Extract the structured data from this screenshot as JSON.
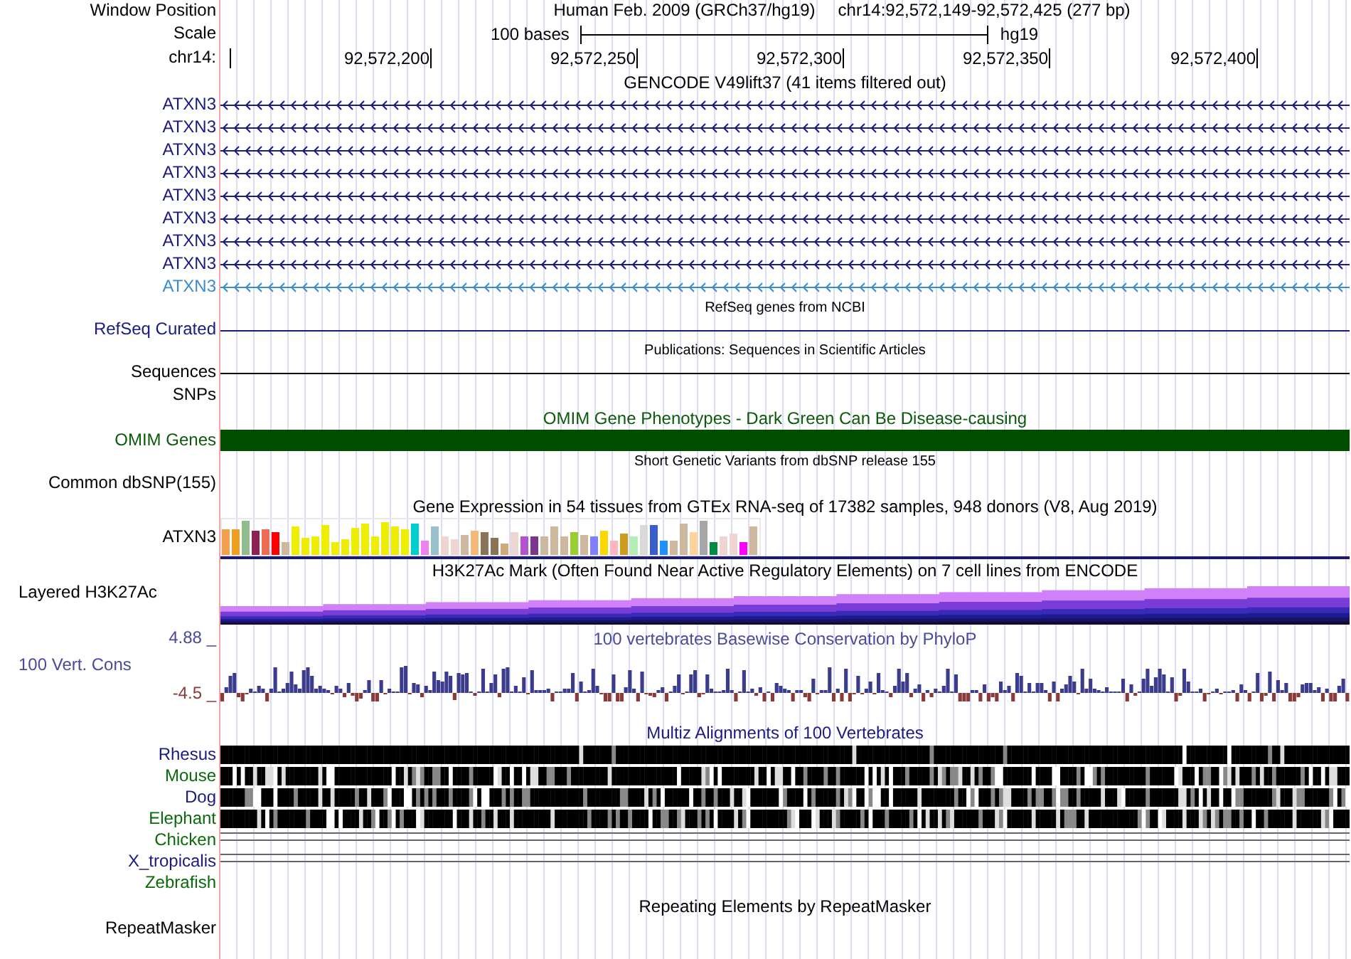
{
  "header": {
    "row_labels": [
      "Window Position",
      "Scale",
      "chr14:"
    ],
    "assembly": "Human Feb. 2009 (GRCh37/hg19)",
    "position": "chr14:92,572,149-92,572,425 (277 bp)",
    "scale_text": "100 bases",
    "scale_assembly": "hg19",
    "ticks": [
      "92,572,200",
      "92,572,250",
      "92,572,300",
      "92,572,350",
      "92,572,400"
    ]
  },
  "tracks": [
    {
      "kind": "title",
      "text": "GENCODE V49lift37 (41 items filtered out)",
      "small": false,
      "color": "#000000"
    },
    {
      "kind": "gene",
      "label": "ATXN3",
      "color": "#1a1a80"
    },
    {
      "kind": "gene",
      "label": "ATXN3",
      "color": "#1a1a80"
    },
    {
      "kind": "gene",
      "label": "ATXN3",
      "color": "#1a1a80"
    },
    {
      "kind": "gene",
      "label": "ATXN3",
      "color": "#1a1a80"
    },
    {
      "kind": "gene",
      "label": "ATXN3",
      "color": "#1a1a80"
    },
    {
      "kind": "gene",
      "label": "ATXN3",
      "color": "#1a1a80"
    },
    {
      "kind": "gene",
      "label": "ATXN3",
      "color": "#1a1a80"
    },
    {
      "kind": "gene",
      "label": "ATXN3",
      "color": "#1a1a80"
    },
    {
      "kind": "gene",
      "label": "ATXN3",
      "color": "#3a8cd0"
    },
    {
      "kind": "title",
      "text": "RefSeq genes from NCBI",
      "small": true,
      "color": "#000000"
    },
    {
      "kind": "line",
      "label": "RefSeq Curated",
      "color": "#1a1a80"
    },
    {
      "kind": "title",
      "text": "Publications: Sequences in Scientific Articles",
      "small": true,
      "color": "#000000"
    },
    {
      "kind": "line",
      "label": "Sequences",
      "color": "#000000"
    },
    {
      "kind": "empty",
      "label": "SNPs",
      "color": "#000000"
    },
    {
      "kind": "title",
      "text": "OMIM Gene Phenotypes - Dark Green Can Be Disease-causing",
      "small": false,
      "color": "#0a5a0a"
    },
    {
      "kind": "bar",
      "label": "OMIM Genes",
      "color": "#0a5a0a"
    },
    {
      "kind": "title",
      "text": "Short Genetic Variants from dbSNP release 155",
      "small": true,
      "color": "#000000"
    },
    {
      "kind": "empty",
      "label": "Common dbSNP(155)",
      "color": "#000000"
    },
    {
      "kind": "title",
      "text": "Gene Expression in 54 tissues from GTEx RNA-seq of 17382 samples, 948 donors (V8, Aug 2019)",
      "small": false,
      "color": "#000000"
    },
    {
      "kind": "expression",
      "label": "ATXN3",
      "color": "#000000"
    },
    {
      "kind": "title",
      "text": "H3K27Ac Mark (Often Found Near Active Regulatory Elements) on 7 cell lines from ENCODE",
      "small": false,
      "color": "#000000"
    },
    {
      "kind": "layered",
      "label": "Layered H3K27Ac",
      "color": "#000000"
    },
    {
      "kind": "wiggle",
      "label": "100 Vert. Cons",
      "title": "100 vertebrates Basewise Conservation by PhyloP",
      "max": "4.88 _",
      "min": "-4.5 _",
      "color": "#4a4a9a"
    },
    {
      "kind": "title",
      "text": "Multiz Alignments of 100 Vertebrates",
      "small": false,
      "color": "#1a1a80"
    },
    {
      "kind": "alignment",
      "label": "Rhesus",
      "color": "#1a1a80"
    },
    {
      "kind": "alignment",
      "label": "Mouse",
      "color": "#0a6a0a"
    },
    {
      "kind": "alignment",
      "label": "Dog",
      "color": "#1a1a80"
    },
    {
      "kind": "alignment",
      "label": "Elephant",
      "color": "#0a6a0a"
    },
    {
      "kind": "double_line",
      "label": "Chicken",
      "color": "#0a6a0a"
    },
    {
      "kind": "double_line",
      "label": "X_tropicalis",
      "color": "#1a1a80"
    },
    {
      "kind": "empty",
      "label": "Zebrafish",
      "color": "#0a6a0a"
    },
    {
      "kind": "title",
      "text": "Repeating Elements by RepeatMasker",
      "small": false,
      "color": "#000000"
    },
    {
      "kind": "empty",
      "label": "RepeatMasker",
      "color": "#000000"
    }
  ]
}
